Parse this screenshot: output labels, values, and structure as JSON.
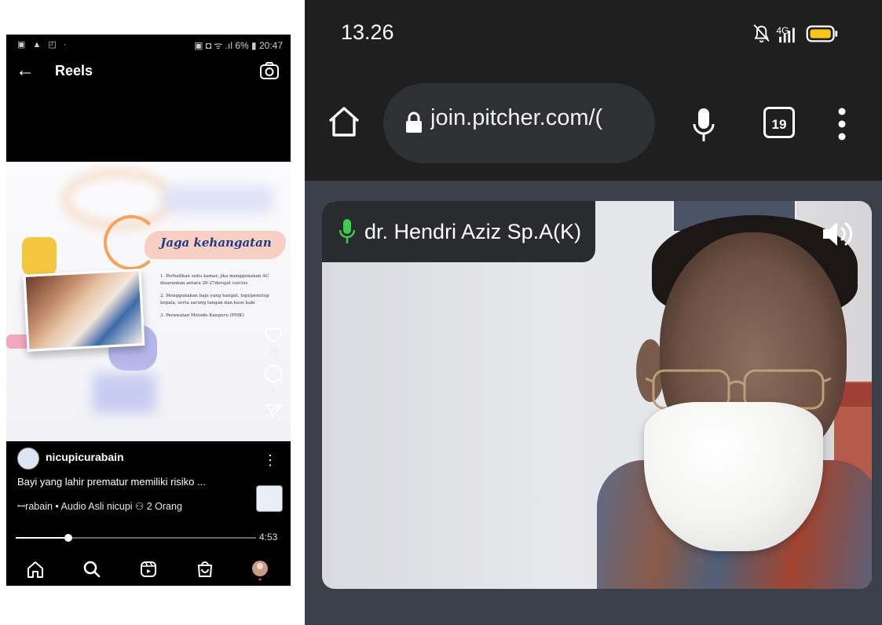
{
  "left_phone": {
    "status": {
      "left_icons": "▣ ▲ ◰ ·",
      "right_text": "▣ ◘ ᯤ .ıl 6% ▮ 20:47"
    },
    "header": {
      "back_icon": "←",
      "title": "Reels",
      "camera_icon": "camera-icon"
    },
    "slide": {
      "title": "Jaga kehangatan",
      "items": [
        "1.  Perhatikan suhu kamar, jika menggunakan AC disarankan antara 26-27derajat celcius",
        "2. Menggunakan baju yang hangat, topi/penutup kepala, serta sarung tangan dan kaus kaki",
        "3. Perawatan Metode Kanguru (PMK)"
      ]
    },
    "actions": {
      "likes": "28",
      "comments": "4"
    },
    "post": {
      "username": "nicupicurabain",
      "caption": "Bayi yang lahir prematur memiliki risiko ...",
      "audio_line": "ꟷrabain • Audio Asli   nicupi   ⚇ 2 Orang",
      "more_icon": "⋮",
      "duration": "4:53",
      "progress": 0.22
    },
    "nav": [
      "home-icon",
      "search-icon",
      "reels-icon",
      "shop-icon",
      "profile-avatar"
    ]
  },
  "right_phone": {
    "status": {
      "time": "13.26",
      "network": "4G"
    },
    "browser": {
      "url": "join.pitcher.com/(",
      "tab_count": "19"
    },
    "meeting": {
      "participant_name": "dr. Hendri Aziz Sp.A(K)",
      "mic_color": "#3ccf4e"
    }
  }
}
